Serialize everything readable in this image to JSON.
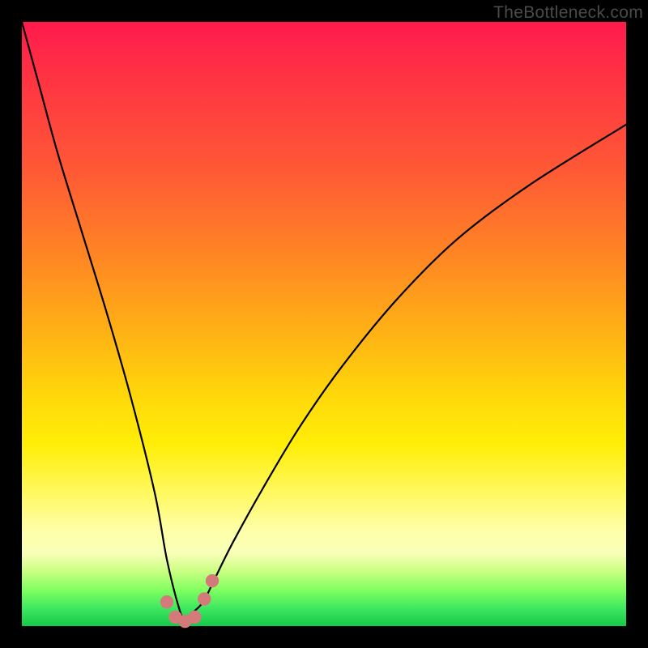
{
  "watermark": {
    "text": "TheBottleneck.com"
  },
  "chart_data": {
    "type": "line",
    "title": "",
    "xlabel": "",
    "ylabel": "",
    "xlim": [
      0,
      100
    ],
    "ylim": [
      0,
      100
    ],
    "background_gradient": {
      "top_color": "#ff1a4d",
      "bottom_color": "#15c84a",
      "description": "vertical rainbow gradient red→yellow→green representing bottleneck severity (red high, green low)"
    },
    "series": [
      {
        "name": "bottleneck-curve",
        "description": "V-shaped curve; steep left descent to near-zero minimum around x≈27, then concave rise to the right",
        "x": [
          0,
          3,
          6,
          10,
          14,
          18,
          22,
          24,
          26,
          27,
          28,
          30,
          32,
          35,
          40,
          46,
          53,
          62,
          72,
          84,
          100
        ],
        "y": [
          100,
          89,
          78,
          65,
          52,
          38,
          22,
          11,
          3,
          1,
          2,
          4,
          8,
          14,
          23,
          33,
          43,
          54,
          64,
          73,
          83
        ]
      }
    ],
    "markers": [
      {
        "name": "min-region-dot-1",
        "x": 24.0,
        "y": 4.0,
        "color": "#d47a7a",
        "r": 1.1
      },
      {
        "name": "min-region-dot-2",
        "x": 25.4,
        "y": 1.5,
        "color": "#d47a7a",
        "r": 1.1
      },
      {
        "name": "min-region-dot-3",
        "x": 27.0,
        "y": 0.8,
        "color": "#d47a7a",
        "r": 1.1
      },
      {
        "name": "min-region-dot-4",
        "x": 28.6,
        "y": 1.5,
        "color": "#d47a7a",
        "r": 1.1
      },
      {
        "name": "min-region-dot-5",
        "x": 30.2,
        "y": 4.5,
        "color": "#d47a7a",
        "r": 1.1
      },
      {
        "name": "min-region-dot-6",
        "x": 31.5,
        "y": 7.5,
        "color": "#d47a7a",
        "r": 1.1
      }
    ]
  }
}
